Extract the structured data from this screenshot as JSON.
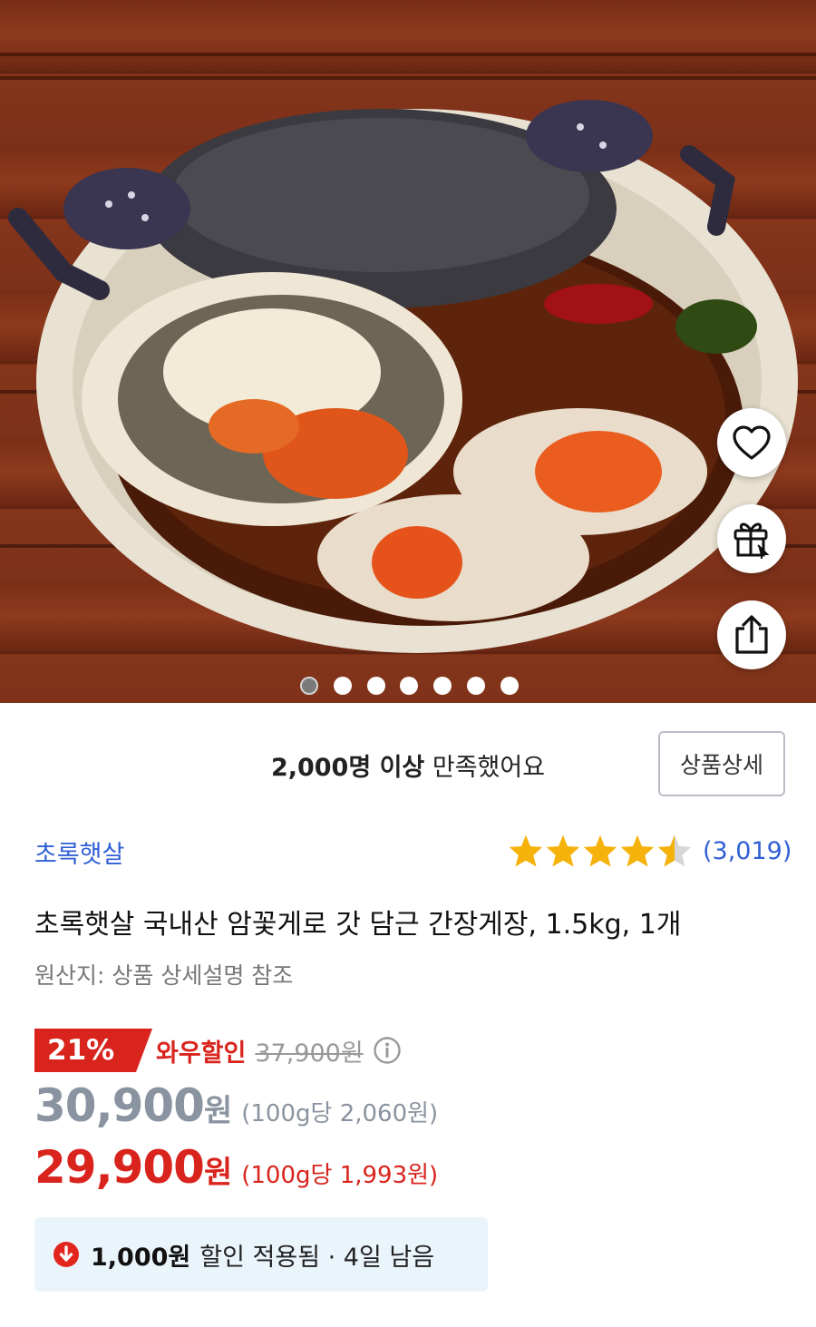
{
  "gallery": {
    "image_alt": "간장게장 상품 이미지",
    "dot_count": 7,
    "active_index": 0
  },
  "side_actions": {
    "icons": [
      "heart-icon",
      "gift-icon",
      "share-icon"
    ]
  },
  "satisfaction": {
    "bold": "2,000명 이상",
    "rest": " 만족했어요",
    "detail_button": "상품상세"
  },
  "product": {
    "brand": "초록햇살",
    "rating": 4.5,
    "review_count": "(3,019)",
    "title": "초록햇살 국내산 암꽃게로 갓 담근 간장게장, 1.5kg, 1개",
    "origin": "원산지: 상품 상세설명 참조"
  },
  "price": {
    "discount_rate": "21%",
    "discount_label": "와우할인",
    "original_price": "37,900원",
    "sale_price": "30,900",
    "sale_currency": "원",
    "sale_unit_price": "(100g당 2,060원)",
    "final_price": "29,900",
    "final_currency": "원",
    "final_unit_price": "(100g당 1,993원)"
  },
  "coupon": {
    "amount": "1,000원",
    "text": "할인 적용됨 · 4일 남음"
  },
  "colors": {
    "accent_red": "#d9231d",
    "link_blue": "#3160d6",
    "star_gold": "#f5b20b",
    "coupon_bg": "#eaf4fb"
  }
}
